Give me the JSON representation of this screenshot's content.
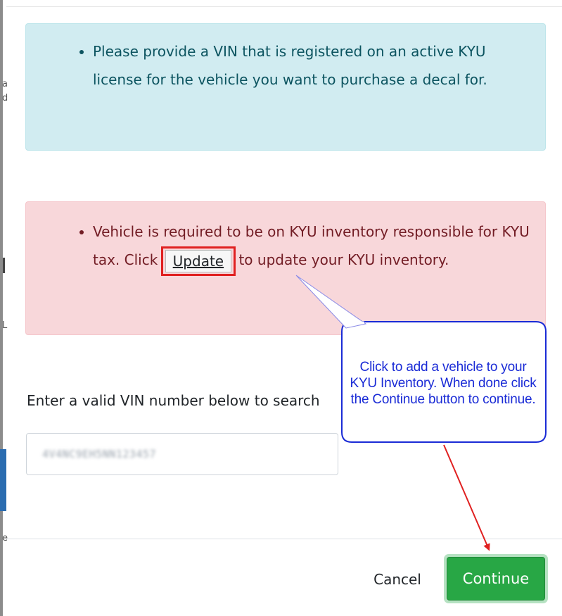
{
  "left_edge": {
    "fragments": [
      "a",
      "d",
      "L",
      "e"
    ]
  },
  "info_alert": {
    "text": "Please provide a VIN that is registered on an active KYU license for the vehicle you want to purchase a decal for."
  },
  "danger_alert": {
    "text_before": "Vehicle is required to be on KYU inventory responsible for KYU tax. Click",
    "update_label": "Update",
    "text_after": "to update your KYU inventory."
  },
  "search": {
    "label": "Enter a valid VIN number below to search",
    "vin_value": "4V4NC9EH5NN123457"
  },
  "footer": {
    "cancel_label": "Cancel",
    "continue_label": "Continue"
  },
  "callout": {
    "text": "Click to add a vehicle to your KYU Inventory. When done click the Continue button to continue."
  },
  "colors": {
    "info_bg": "#d1ecf1",
    "danger_bg": "#f8d7da",
    "highlight": "#e02020",
    "continue": "#28a745",
    "callout_text": "#1a2bd6"
  }
}
